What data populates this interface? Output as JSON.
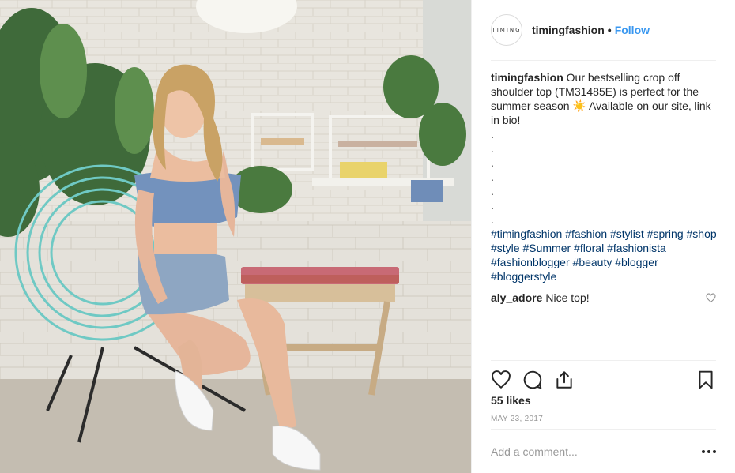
{
  "post": {
    "account": {
      "username": "timingfashion",
      "avatar_text": "TIMING",
      "separator": "•",
      "follow_label": "Follow"
    },
    "caption": {
      "username": "timingfashion",
      "text": "Our bestselling crop off shoulder top (TM31485E) is perfect for the summer season ☀️ Available on our site, link in bio!",
      "dots": [
        ".",
        ".",
        ".",
        ".",
        ".",
        ".",
        "."
      ],
      "hashtags": [
        "#timingfashion",
        "#fashion",
        "#stylist",
        "#spring",
        "#shop",
        "#style",
        "#Summer",
        "#floral",
        "#fashionista",
        "#fashionblogger",
        "#beauty",
        "#blogger",
        "#bloggerstyle"
      ]
    },
    "comments": [
      {
        "username": "aly_adore",
        "text": "Nice top!"
      }
    ],
    "likes": "55 likes",
    "date": "MAY 23, 2017",
    "add_comment_placeholder": "Add a comment...",
    "icons": {
      "like": "heart-icon",
      "comment": "comment-icon",
      "share": "share-icon",
      "save": "bookmark-icon",
      "more": "more-options-icon"
    },
    "colors": {
      "link": "#3897f0",
      "hashtag": "#003569",
      "muted": "#999999"
    }
  }
}
